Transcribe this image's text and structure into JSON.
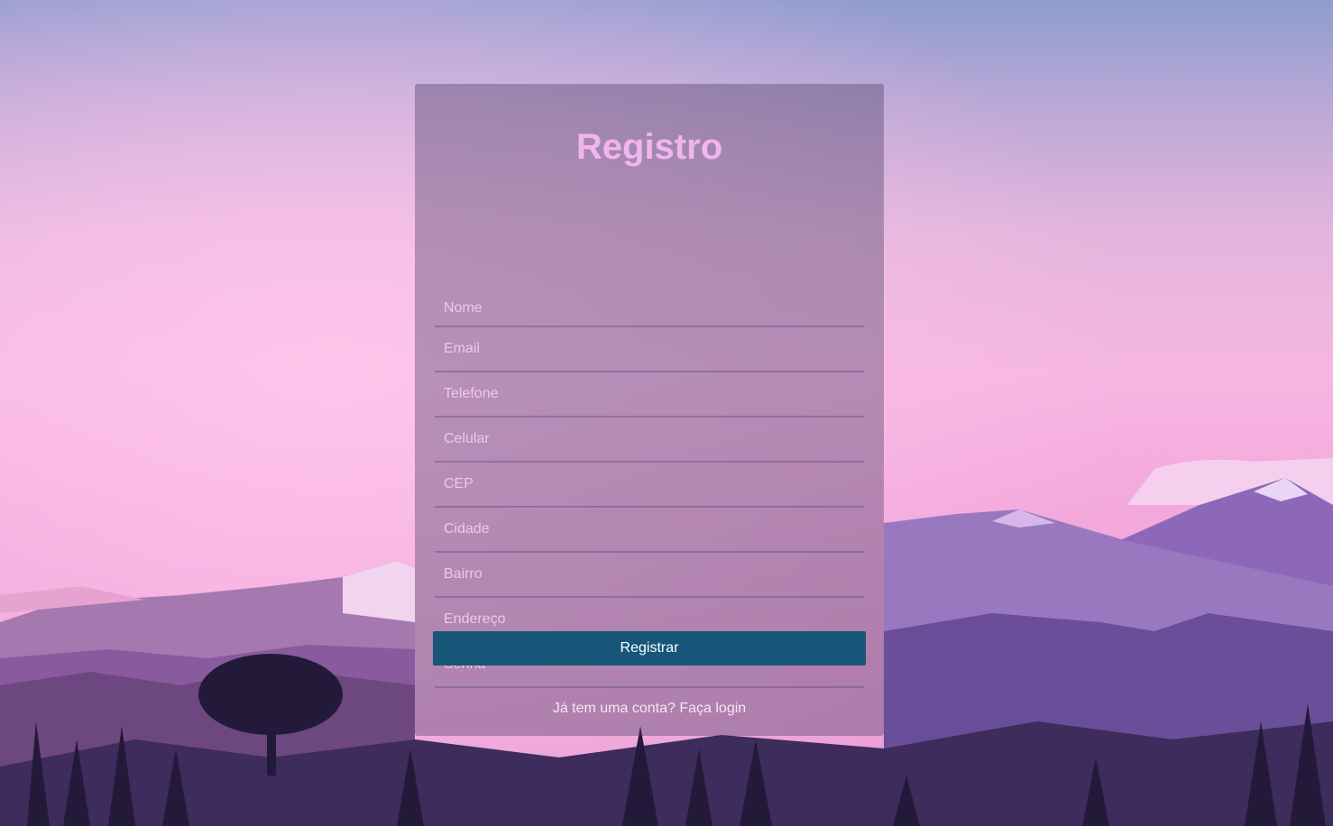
{
  "form": {
    "title": "Registro",
    "fields": [
      {
        "name": "nome",
        "placeholder": "Nome",
        "value": ""
      },
      {
        "name": "email",
        "placeholder": "Email",
        "value": ""
      },
      {
        "name": "telefone",
        "placeholder": "Telefone",
        "value": ""
      },
      {
        "name": "celular",
        "placeholder": "Celular",
        "value": ""
      },
      {
        "name": "cep",
        "placeholder": "CEP",
        "value": ""
      },
      {
        "name": "cidade",
        "placeholder": "Cidade",
        "value": ""
      },
      {
        "name": "bairro",
        "placeholder": "Bairro",
        "value": ""
      },
      {
        "name": "endereco",
        "placeholder": "Endereço",
        "value": ""
      },
      {
        "name": "senha",
        "placeholder": "Senha",
        "value": ""
      }
    ],
    "submit_label": "Registrar",
    "login_prompt": "Já tem uma conta?",
    "login_link": "Faça login"
  },
  "colors": {
    "title": "#f1b4ee",
    "button": "#175679",
    "button_text": "#ffffff"
  }
}
